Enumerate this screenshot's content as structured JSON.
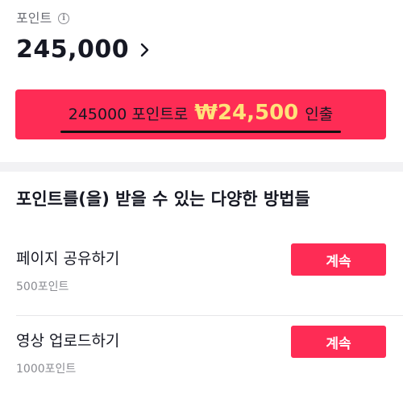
{
  "points": {
    "label": "포인트",
    "info_icon": "info-icon",
    "balance": "245,000",
    "chevron_icon": "chevron-right-icon"
  },
  "cashout": {
    "prefix": "245000 포인트로",
    "amount": "₩24,500",
    "suffix": "인출"
  },
  "earn": {
    "title": "포인트를(을) 받을 수 있는 다양한 방법들",
    "items": [
      {
        "title": "페이지 공유하기",
        "reward": "500포인트",
        "button": "계속"
      },
      {
        "title": "영상 업로드하기",
        "reward": "1000포인트",
        "button": "계속"
      }
    ]
  },
  "colors": {
    "accent": "#fe2c55",
    "amount_highlight": "#ffe27a",
    "text_primary": "#161823",
    "text_secondary": "#8a8b91"
  }
}
